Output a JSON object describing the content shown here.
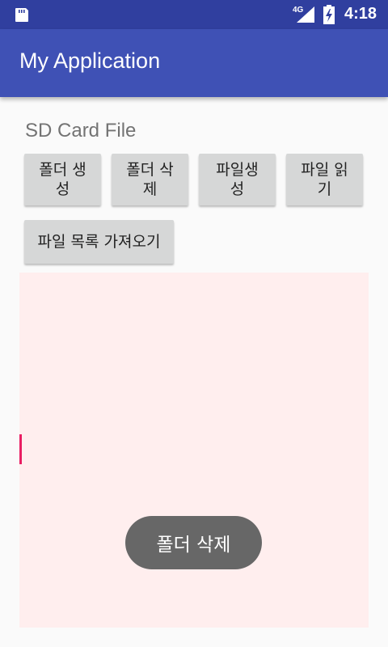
{
  "status_bar": {
    "network": "4G",
    "time": "4:18"
  },
  "app_bar": {
    "title": "My Application"
  },
  "main": {
    "section_title": "SD Card File",
    "buttons": [
      {
        "label": "폴더 생\n성"
      },
      {
        "label": "폴더 삭\n제"
      },
      {
        "label": "파일생\n성"
      },
      {
        "label": "파일 읽\n기"
      },
      {
        "label": "파일 목록 가져오기"
      }
    ],
    "text_area": {
      "value": ""
    }
  },
  "toast": {
    "message": "폴더 삭제"
  },
  "colors": {
    "status_bar": "#303f9f",
    "primary": "#3f51b5",
    "accent": "#e91e63",
    "text_area_bg": "#ffeeee",
    "button_bg": "#d6d7d7",
    "toast_bg": "#676767"
  }
}
